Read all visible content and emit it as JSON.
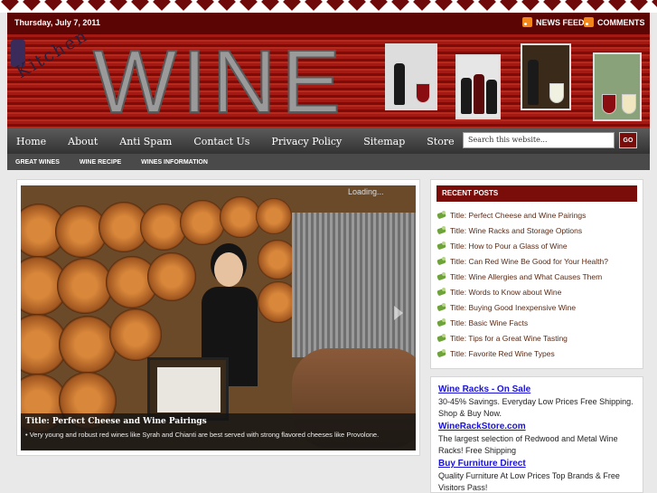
{
  "topbar": {
    "date": "Thursday, July 7, 2011",
    "news_feed": "NEWS FEED",
    "comments": "COMMENTS"
  },
  "banner": {
    "title": "WINE",
    "subtitle": "Kitchen"
  },
  "nav": {
    "items": [
      "Home",
      "About",
      "Anti Spam",
      "Contact Us",
      "Privacy Policy",
      "Sitemap",
      "Store"
    ],
    "search_placeholder": "Search this website...",
    "go": "GO"
  },
  "subnav": {
    "items": [
      "GREAT WINES",
      "WINE RECIPE",
      "WINES INFORMATION"
    ]
  },
  "slider": {
    "loading": "Loading...",
    "caption_title": "Title: Perfect Cheese and Wine Pairings",
    "caption_text": "• Very young and robust red wines like Syrah and Chianti are best served with strong flavored cheeses like Provolone."
  },
  "sidebar": {
    "heading": "RECENT POSTS",
    "posts": [
      "Title: Perfect Cheese and Wine Pairings",
      "Title: Wine Racks and Storage Options",
      "Title: How to Pour a Glass of Wine",
      "Title: Can Red Wine Be Good for Your Health?",
      "Title: Wine Allergies and What Causes Them",
      "Title: Words to Know about Wine",
      "Title: Buying Good Inexpensive Wine",
      "Title: Basic Wine Facts",
      "Title: Tips for a Great Wine Tasting",
      "Title: Favorite Red Wine Types"
    ]
  },
  "ads": [
    {
      "title": "Wine Racks - On Sale",
      "text": "30-45% Savings. Everyday Low Prices Free Shipping. Shop & Buy Now."
    },
    {
      "title": "WineRackStore.com",
      "text": "The largest selection of Redwood and Metal Wine Racks! Free Shipping"
    },
    {
      "title": "Buy Furniture Direct",
      "text": "Quality Furniture At Low Prices Top Brands & Free Visitors Pass!"
    }
  ],
  "colors": {
    "brand_dark_red": "#5b0505",
    "accent_red": "#7a0c0a",
    "ad_link": "#1a12d8"
  }
}
